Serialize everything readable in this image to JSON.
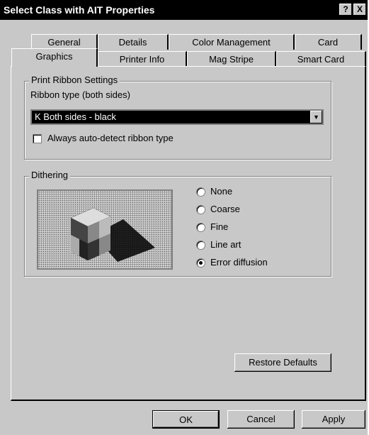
{
  "window": {
    "title": "Select Class with AIT Properties",
    "help_glyph": "?",
    "close_glyph": "X"
  },
  "tabs": {
    "back_row": [
      "General",
      "Details",
      "Color Management",
      "Card"
    ],
    "front_row": [
      "Graphics",
      "Printer Info",
      "Mag Stripe",
      "Smart Card"
    ],
    "active": "Graphics"
  },
  "ribbon": {
    "group_title": "Print Ribbon Settings",
    "type_label": "Ribbon type (both sides)",
    "type_value": "K Both sides - black",
    "auto_detect_label": "Always auto-detect ribbon type",
    "auto_detect_checked": false
  },
  "dithering": {
    "group_title": "Dithering",
    "options": [
      "None",
      "Coarse",
      "Fine",
      "Line art",
      "Error diffusion"
    ],
    "selected": "Error diffusion"
  },
  "buttons": {
    "restore_defaults": "Restore Defaults",
    "ok": "OK",
    "cancel": "Cancel",
    "apply": "Apply"
  }
}
